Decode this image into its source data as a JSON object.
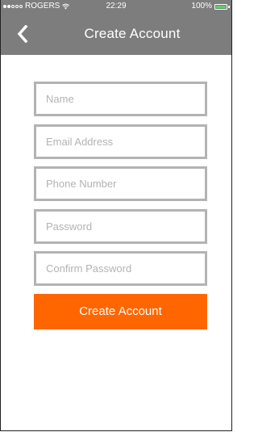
{
  "status_bar": {
    "carrier": "ROGERS",
    "time": "22:29",
    "battery": "100%",
    "signal_bars_filled": 2,
    "signal_bars_total": 5,
    "battery_level": 1.0,
    "wifi_icon": "wifi-icon",
    "battery_icon": "battery-icon"
  },
  "nav": {
    "back_icon": "chevron-left-icon",
    "title": "Create Account"
  },
  "form": {
    "fields": [
      {
        "placeholder": "Name",
        "value": ""
      },
      {
        "placeholder": "Email Address",
        "value": ""
      },
      {
        "placeholder": "Phone Number",
        "value": ""
      },
      {
        "placeholder": "Password",
        "value": ""
      },
      {
        "placeholder": "Confirm Password",
        "value": ""
      }
    ],
    "submit_label": "Create Account"
  },
  "colors": {
    "bar_background": "#7d7d7d",
    "accent": "#ff6600",
    "field_border": "#b3b3b3",
    "placeholder_text": "#b3b3b3",
    "battery_fill": "#4cd964"
  }
}
